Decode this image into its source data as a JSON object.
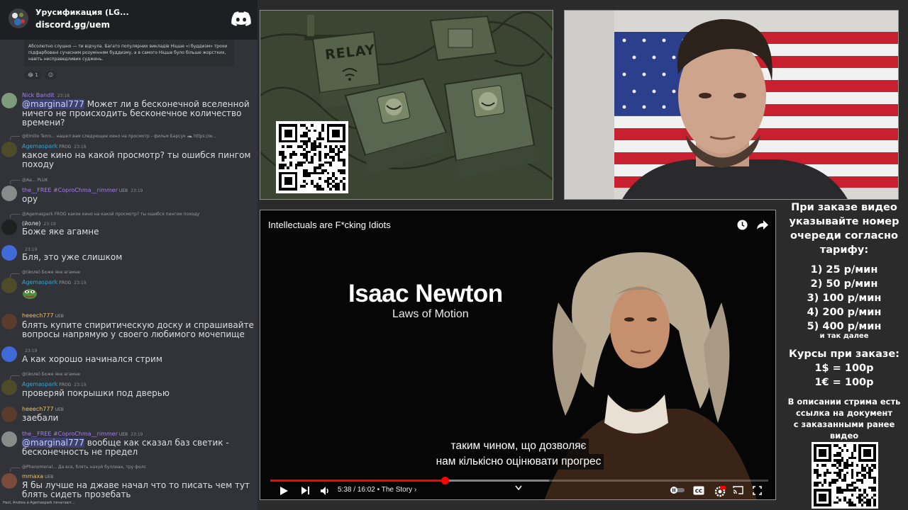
{
  "chat": {
    "server_name": "Урусификация (LG...",
    "server_invite": "discord.gg/uem",
    "embed_text": "Абсолютно слушно — ти відчула. Багато популярних викладів Ніцше «і буддизм» трохи підфарбовані сучасним розумінням буддизму, а в самого Ніцше було більше жорстких, навіть несправедливих суджень.",
    "reactions": [
      {
        "emoji": "😂",
        "count": "1"
      },
      {
        "emoji": "☺",
        "count": ""
      }
    ],
    "messages": [
      {
        "user": "Nick Bandit",
        "time": "23:18",
        "mention": "@marginal777",
        "text": " Может ли в бесконечной вселенной ничего не происходить бесконечное количество времени?"
      },
      {
        "reply": "@Emilio Terro... нашел вам следующее кино на просмотр - фильм Барсук 🦡 https://w...",
        "user": "Agemaspark",
        "badge": "FROG",
        "time": "23:18",
        "text": "какое кино на какой просмотр? ты ошибся пингом походу"
      },
      {
        "reply": "@Aa... PLUK",
        "user": "the__FREE #CoproChma__rimmer",
        "badge": "UEB",
        "time": "23:19",
        "text": "ору"
      },
      {
        "reply": "@Agemaspark FROG какое кино на какой просмотр? ты ошибся пингом походу",
        "user": "(йоле)",
        "time": "23:19",
        "text": "Боже яке агамне"
      },
      {
        "user": "",
        "time": "23:19",
        "text": "Бля, это уже слишком"
      },
      {
        "reply": "@(йоле) Боже яке агамне",
        "user": "Agemaspark",
        "badge": "FROG",
        "time": "23:19",
        "text": ""
      },
      {
        "user": "heeech777",
        "badge": "UEB",
        "time": "",
        "text": "блять купите спиритическую доску и спрашивайте вопросы напрямую у своего любимого мочепище"
      },
      {
        "user": "",
        "time": "23:19",
        "text": "А как хорошо начинался стрим"
      },
      {
        "reply": "@(йоле) Боже яке агамне",
        "user": "Agemaspark",
        "badge": "FROG",
        "time": "23:19",
        "text": "проверяй покрышки под дверью"
      },
      {
        "user": "heeech777",
        "badge": "UEB",
        "time": "",
        "text": "заебали"
      },
      {
        "user": "the__FREE #CoproChma__rimmer",
        "badge": "UEB",
        "time": "23:19",
        "mention": "@marginal777",
        "text": " вообще как сказал баз светик - бесконечность не предел"
      },
      {
        "reply": "@Phenomenal... Да все, блять нахуй  буллиан, тру фолс",
        "user": "mmaxa",
        "badge": "UEB",
        "time": "",
        "text": "Я бы лучше на джаве начал что то писать чем тут блять сидеть прозебать"
      }
    ],
    "typing": "Hezl, Andrea и Agemaspark печатают..."
  },
  "relay_panel": {
    "label": "RELAY"
  },
  "video": {
    "title": "Intellectuals are F*cking Idiots",
    "heading": "Isaac Newton",
    "subheading": "Laws of Motion",
    "subtitle_lines": [
      "таким чином, що дозволяє",
      "нам кількісно оцінювати прогрес"
    ],
    "time_current": "5:38",
    "time_total": "16:02",
    "time_separator": " / ",
    "chapter": " • The Story ›",
    "progress_fraction": 0.351,
    "buffer_fraction": 0.56,
    "accent_color": "#ff0000"
  },
  "info": {
    "lines_big": [
      "При заказе видео",
      "указывайте номер",
      "очереди согласно",
      "тарифу:"
    ],
    "tariffs": [
      "1) 25 р/мин",
      "2) 50 р/мин",
      "3) 100 р/мин",
      "4) 200 р/мин",
      "5) 400 р/мин"
    ],
    "and_so_on": "и так далее",
    "courses_title": "Курсы при заказе:",
    "courses": [
      "1$ = 100р",
      "1€ = 100р"
    ],
    "doc_lines": [
      "В описании стрима есть",
      "ссылка на документ",
      "с заказанными ранее",
      "видео"
    ]
  }
}
